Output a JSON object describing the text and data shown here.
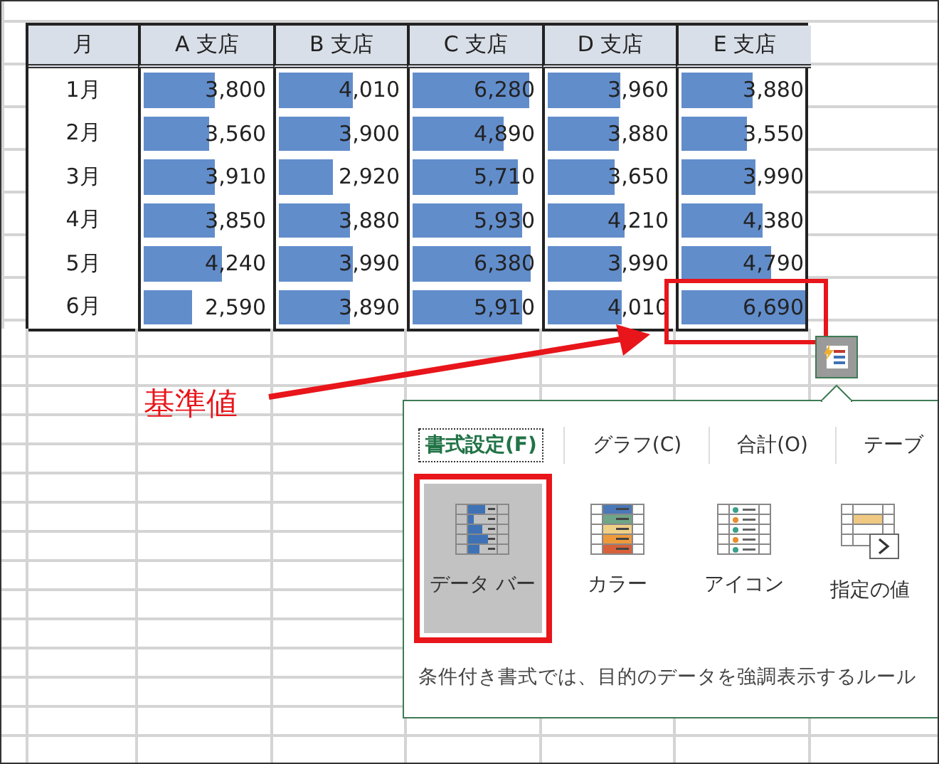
{
  "table": {
    "columns": [
      "月",
      "A 支店",
      "B 支店",
      "C 支店",
      "D 支店",
      "E 支店"
    ],
    "rows": [
      {
        "month": "1月",
        "cells": [
          {
            "value": "3,800",
            "level": 0.57,
            "highlighted": false
          },
          {
            "value": "4,010",
            "level": 0.6,
            "highlighted": false
          },
          {
            "value": "6,280",
            "level": 0.94,
            "highlighted": false
          },
          {
            "value": "3,960",
            "level": 0.59,
            "highlighted": false
          },
          {
            "value": "3,880",
            "level": 0.58,
            "highlighted": false
          }
        ]
      },
      {
        "month": "2月",
        "cells": [
          {
            "value": "3,560",
            "level": 0.53,
            "highlighted": false
          },
          {
            "value": "3,900",
            "level": 0.58,
            "highlighted": false
          },
          {
            "value": "4,890",
            "level": 0.73,
            "highlighted": false
          },
          {
            "value": "3,880",
            "level": 0.58,
            "highlighted": false
          },
          {
            "value": "3,550",
            "level": 0.53,
            "highlighted": false
          }
        ]
      },
      {
        "month": "3月",
        "cells": [
          {
            "value": "3,910",
            "level": 0.58,
            "highlighted": false
          },
          {
            "value": "2,920",
            "level": 0.44,
            "highlighted": false
          },
          {
            "value": "5,710",
            "level": 0.85,
            "highlighted": false
          },
          {
            "value": "3,650",
            "level": 0.55,
            "highlighted": false
          },
          {
            "value": "3,990",
            "level": 0.6,
            "highlighted": false
          }
        ]
      },
      {
        "month": "4月",
        "cells": [
          {
            "value": "3,850",
            "level": 0.58,
            "highlighted": false
          },
          {
            "value": "3,880",
            "level": 0.58,
            "highlighted": false
          },
          {
            "value": "5,930",
            "level": 0.89,
            "highlighted": false
          },
          {
            "value": "4,210",
            "level": 0.63,
            "highlighted": false
          },
          {
            "value": "4,380",
            "level": 0.65,
            "highlighted": false
          }
        ]
      },
      {
        "month": "5月",
        "cells": [
          {
            "value": "4,240",
            "level": 0.63,
            "highlighted": false
          },
          {
            "value": "3,990",
            "level": 0.6,
            "highlighted": false
          },
          {
            "value": "6,380",
            "level": 0.95,
            "highlighted": false
          },
          {
            "value": "3,990",
            "level": 0.6,
            "highlighted": false
          },
          {
            "value": "4,790",
            "level": 0.72,
            "highlighted": false
          }
        ]
      },
      {
        "month": "6月",
        "cells": [
          {
            "value": "2,590",
            "level": 0.39,
            "highlighted": false
          },
          {
            "value": "3,890",
            "level": 0.58,
            "highlighted": false
          },
          {
            "value": "5,910",
            "level": 0.88,
            "highlighted": false
          },
          {
            "value": "4,010",
            "level": 0.6,
            "highlighted": false
          },
          {
            "value": "6,690",
            "level": 1.0,
            "highlighted": true
          }
        ]
      }
    ]
  },
  "callout": {
    "label": "基準値"
  },
  "quick_analysis": {
    "tabs": [
      {
        "label": "書式設定(F)",
        "selected": true
      },
      {
        "label": "グラフ(C)",
        "selected": false
      },
      {
        "label": "合計(O)",
        "selected": false
      },
      {
        "label": "テーブ",
        "selected": false
      }
    ],
    "options": [
      {
        "kind": "databar",
        "label": "データ バー",
        "selected": true,
        "highlighted": true
      },
      {
        "kind": "color",
        "label": "カラー",
        "selected": false,
        "highlighted": false
      },
      {
        "kind": "icon",
        "label": "アイコン",
        "selected": false,
        "highlighted": false
      },
      {
        "kind": "value",
        "label": "指定の値",
        "selected": false,
        "highlighted": false
      }
    ],
    "description": "条件付き書式では、目的のデータを強調表示するルール"
  }
}
